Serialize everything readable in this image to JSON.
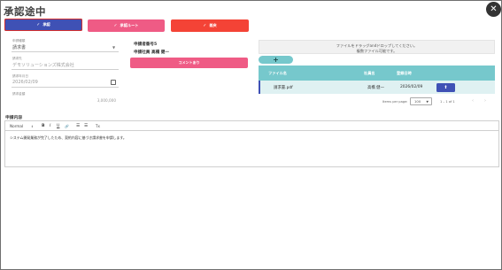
{
  "dialog": {
    "title": "承認途中",
    "close_glyph": "✕"
  },
  "actions": {
    "approve_label": "承認",
    "route_label": "承認ルート",
    "reject_label": "差戻",
    "check_glyph": "✓"
  },
  "form": {
    "application_type_label": "申請種類",
    "application_type_value": "請求書",
    "recipient_label": "請求先",
    "recipient_value": "デモソリューションズ株式会社",
    "request_date_label": "請求年月日",
    "request_date_value": "2026/02/09",
    "amount_label": "請求金額",
    "amount_value": "3,000,000"
  },
  "applicant": {
    "id_line": "申請者番号5",
    "name_line": "申請社員 高橋 健一",
    "comment_button_label": "コメントあり"
  },
  "upload": {
    "drop_line1": "ファイルをドラッグandドロップしてください。",
    "drop_line2": "複数ファイル可能です。",
    "add_glyph": "+"
  },
  "file_table": {
    "headers": [
      "ファイル名",
      "社員名",
      "登録日時"
    ],
    "rows": [
      {
        "file_name": "請求書.pdf",
        "employee": "高橋 健一",
        "date": "2026/02/09"
      }
    ],
    "download_glyph": "⬆"
  },
  "paginator": {
    "items_per_page_label": "Items per page:",
    "page_size": "100",
    "range": "1 – 1 of 1",
    "prev_glyph": "‹",
    "next_glyph": "›"
  },
  "content": {
    "section_title": "申請内容",
    "toolbar": {
      "format": "Normal",
      "bold": "B",
      "italic": "I",
      "underline": "U",
      "link": "🔗",
      "ordered_list": "☰",
      "bullet_list": "☰",
      "clear": "Tx"
    },
    "body_text": "システム開発業務が完了したため、契約内容に基づき請求書を申請します。"
  },
  "colors": {
    "primary": "#3f51b5",
    "pink": "#ef5b85",
    "red": "#f44336",
    "teal": "#76c8cc"
  }
}
